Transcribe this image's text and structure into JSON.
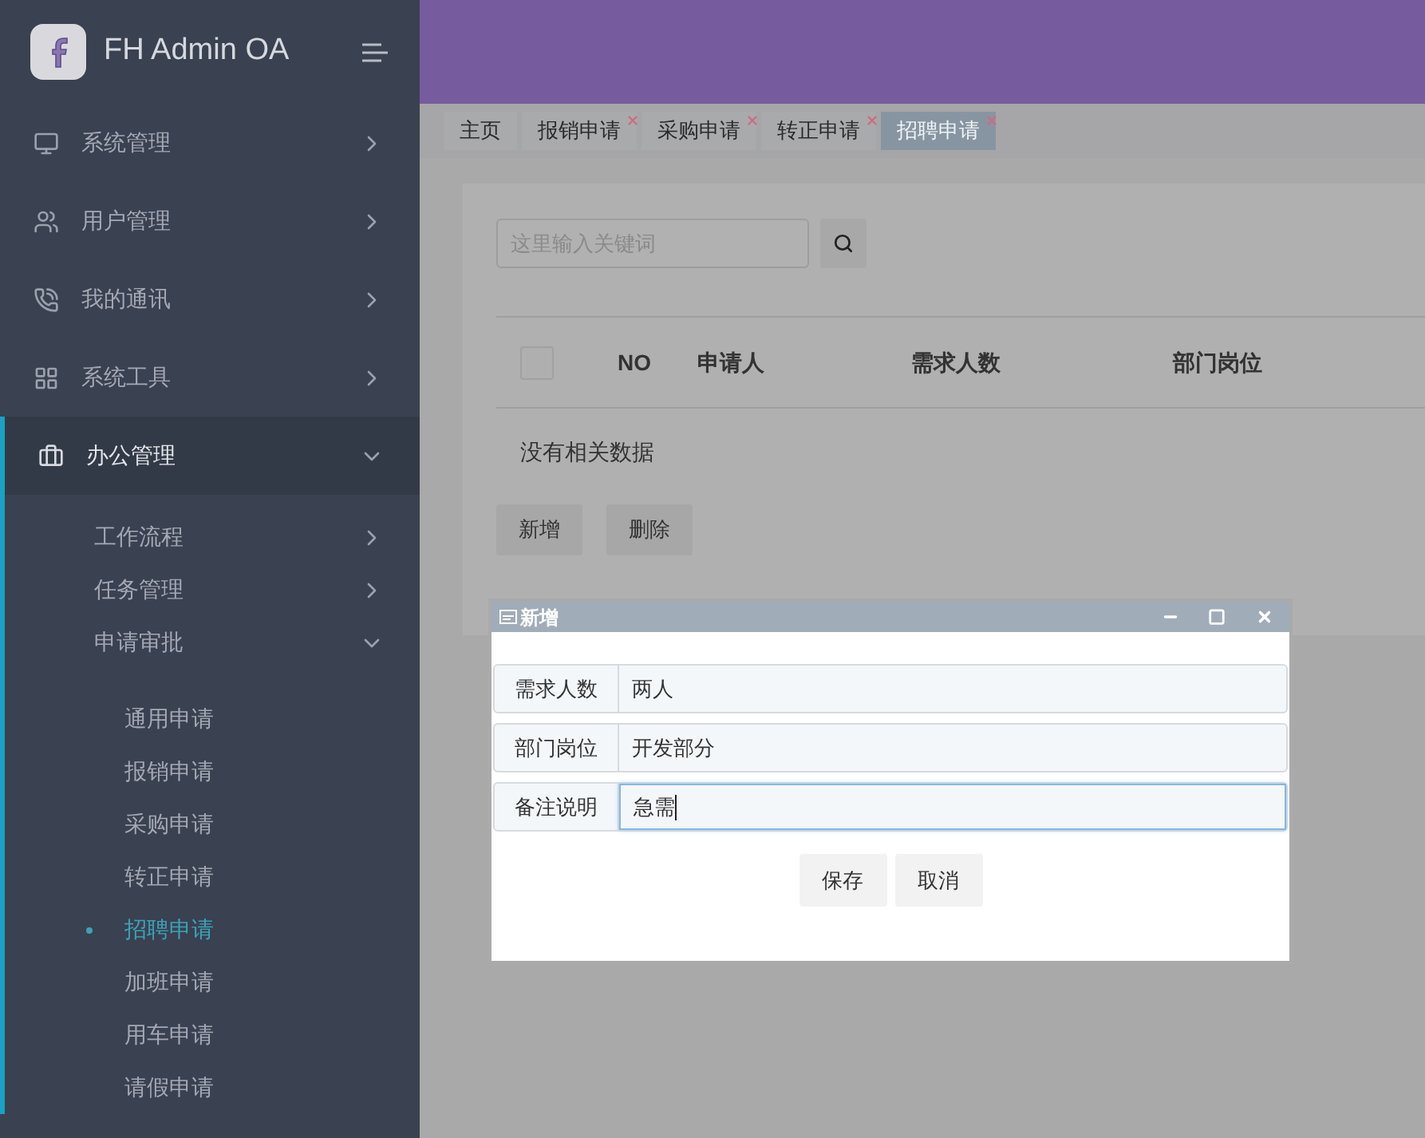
{
  "app": {
    "title": "FH Admin OA"
  },
  "sidebar": {
    "items": [
      {
        "label": "系统管理",
        "expanded": false
      },
      {
        "label": "用户管理",
        "expanded": false
      },
      {
        "label": "我的通讯",
        "expanded": false
      },
      {
        "label": "系统工具",
        "expanded": false
      },
      {
        "label": "办公管理",
        "expanded": true,
        "children": [
          {
            "label": "工作流程",
            "expanded": false
          },
          {
            "label": "任务管理",
            "expanded": false
          },
          {
            "label": "申请审批",
            "expanded": true,
            "children": [
              {
                "label": "通用申请",
                "selected": false
              },
              {
                "label": "报销申请",
                "selected": false
              },
              {
                "label": "采购申请",
                "selected": false
              },
              {
                "label": "转正申请",
                "selected": false
              },
              {
                "label": "招聘申请",
                "selected": true
              },
              {
                "label": "加班申请",
                "selected": false
              },
              {
                "label": "用车申请",
                "selected": false
              },
              {
                "label": "请假申请",
                "selected": false
              }
            ]
          }
        ]
      }
    ]
  },
  "tabs": [
    {
      "label": "主页",
      "selected": false,
      "closable": false
    },
    {
      "label": "报销申请",
      "selected": false,
      "closable": true
    },
    {
      "label": "采购申请",
      "selected": false,
      "closable": true
    },
    {
      "label": "转正申请",
      "selected": false,
      "closable": true
    },
    {
      "label": "招聘申请",
      "selected": true,
      "closable": true
    }
  ],
  "search": {
    "placeholder": "这里输入关键词"
  },
  "table": {
    "select_all": {
      "checked": false
    },
    "columns": [
      "NO",
      "申请人",
      "需求人数",
      "部门岗位"
    ],
    "empty_text": "没有相关数据"
  },
  "buttons": [
    "新增",
    "删除"
  ],
  "dialog": {
    "title": "新增",
    "fields": [
      {
        "label": "需求人数",
        "value": "两人",
        "focused": false
      },
      {
        "label": "部门岗位",
        "value": "开发部分",
        "focused": false
      },
      {
        "label": "备注说明",
        "value": "急需",
        "focused": true
      }
    ],
    "buttons": [
      "保存",
      "取消"
    ]
  }
}
